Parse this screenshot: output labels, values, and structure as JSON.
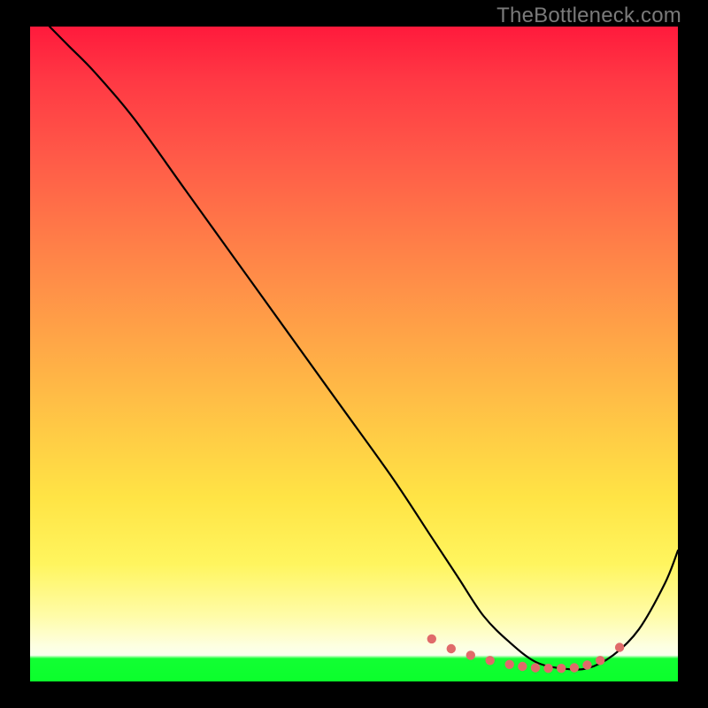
{
  "watermark": {
    "text": "TheBottleneck.com"
  },
  "colors": {
    "page_bg": "#000000",
    "curve_stroke": "#000000",
    "dot_fill": "#e06a6a",
    "gradient_top": "#ff1a3c",
    "gradient_bottom": "#0bff2c"
  },
  "chart_data": {
    "type": "line",
    "title": "",
    "xlabel": "",
    "ylabel": "",
    "xlim": [
      0,
      100
    ],
    "ylim": [
      0,
      100
    ],
    "grid": false,
    "legend": false,
    "series": [
      {
        "name": "bottleneck-curve",
        "x": [
          3,
          6,
          10,
          16,
          24,
          32,
          40,
          48,
          56,
          62,
          66,
          70,
          74,
          78,
          82,
          86,
          90,
          94,
          98,
          100
        ],
        "y": [
          100,
          97,
          93,
          86,
          75,
          64,
          53,
          42,
          31,
          22,
          16,
          10,
          6,
          3,
          2,
          2,
          4,
          8,
          15,
          20
        ]
      }
    ],
    "highlight_dots": {
      "name": "valley-dots",
      "x": [
        62,
        65,
        68,
        71,
        74,
        76,
        78,
        80,
        82,
        84,
        86,
        88,
        91
      ],
      "y": [
        6.5,
        5.0,
        4.0,
        3.2,
        2.6,
        2.3,
        2.1,
        2.0,
        2.0,
        2.1,
        2.5,
        3.2,
        5.2
      ]
    }
  }
}
